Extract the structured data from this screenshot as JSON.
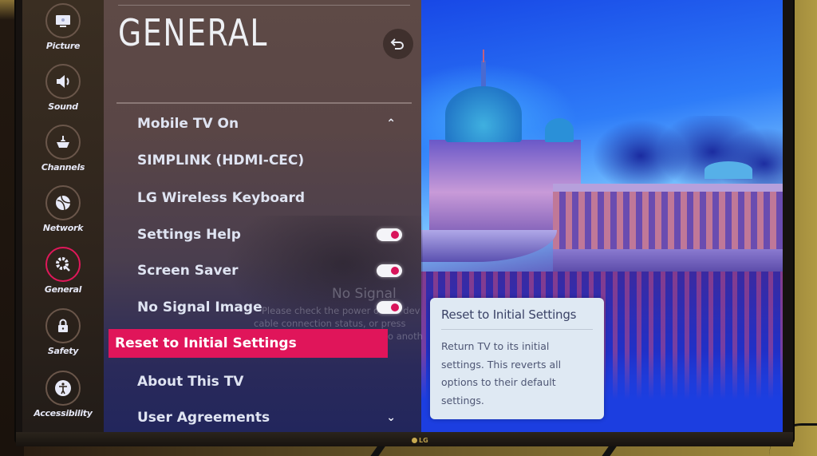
{
  "sidebar": {
    "items": [
      {
        "label": "Picture",
        "icon": "picture-icon",
        "active": false
      },
      {
        "label": "Sound",
        "icon": "sound-icon",
        "active": false
      },
      {
        "label": "Channels",
        "icon": "channels-icon",
        "active": false
      },
      {
        "label": "Network",
        "icon": "network-icon",
        "active": false
      },
      {
        "label": "General",
        "icon": "general-icon",
        "active": true
      },
      {
        "label": "Safety",
        "icon": "safety-icon",
        "active": false
      },
      {
        "label": "Accessibility",
        "icon": "accessibility-icon",
        "active": false
      }
    ]
  },
  "header": {
    "title": "GENERAL",
    "back_icon": "back-icon"
  },
  "menu": {
    "items": [
      {
        "label": "Mobile TV On",
        "control": "scroll-up"
      },
      {
        "label": "SIMPLINK (HDMI-CEC)",
        "control": "none"
      },
      {
        "label": "LG Wireless Keyboard",
        "control": "none"
      },
      {
        "label": "Settings Help",
        "control": "toggle",
        "toggle_on": true
      },
      {
        "label": "Screen Saver",
        "control": "toggle",
        "toggle_on": true
      },
      {
        "label": "No Signal Image",
        "control": "toggle",
        "toggle_on": true
      },
      {
        "label": "Reset to Initial Settings",
        "control": "none",
        "selected": true
      },
      {
        "label": "About This TV",
        "control": "none"
      },
      {
        "label": "User Agreements",
        "control": "scroll-down"
      }
    ]
  },
  "background_overlay": {
    "title": "No Signal",
    "line1": "Please check the power of the dev",
    "line2": "cable connection status, or press",
    "line3": "o anoth"
  },
  "tooltip": {
    "title": "Reset to Initial Settings",
    "body": "Return TV to its initial settings. This reverts all options to their default settings."
  },
  "brand": {
    "logo_text": "LG"
  },
  "colors": {
    "accent": "#e0155a",
    "text": "#dfe4f2",
    "tooltip_bg": "#dfe9f3"
  }
}
